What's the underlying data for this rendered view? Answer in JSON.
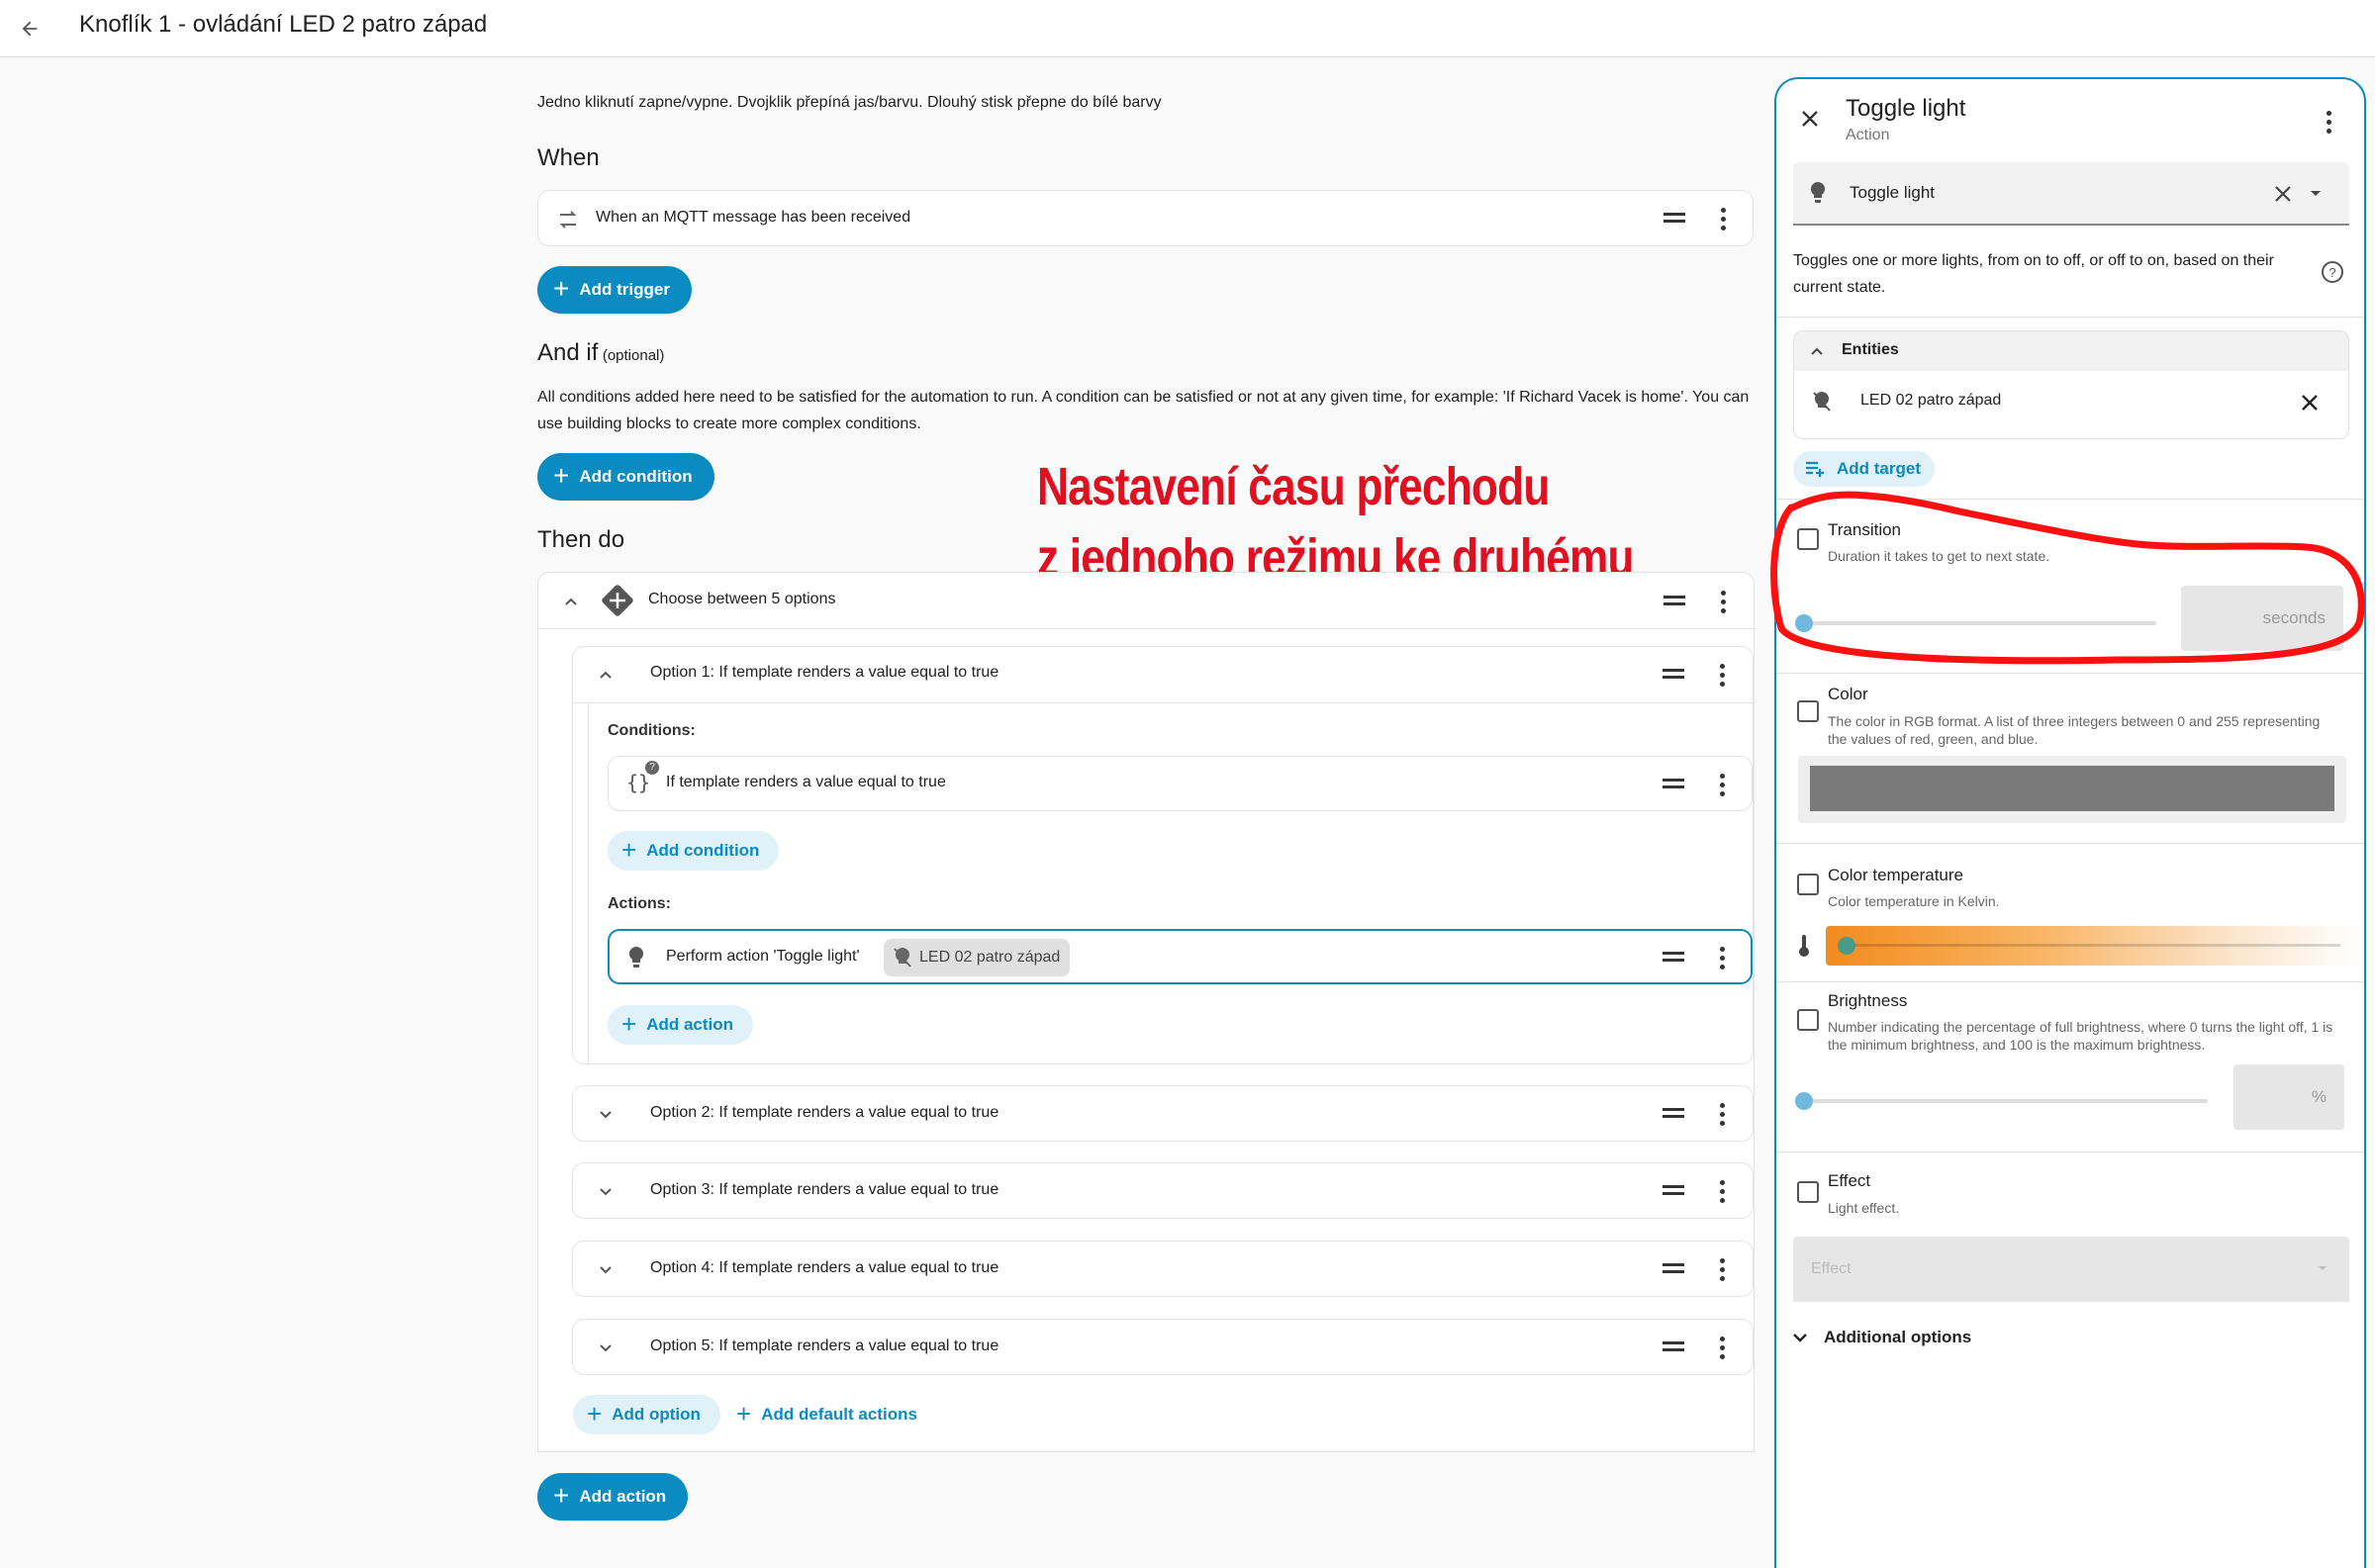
{
  "header": {
    "title": "Knoflík 1 - ovládání LED 2 patro západ"
  },
  "description": "Jedno kliknutí zapne/vypne. Dvojklik přepíná jas/barvu. Dlouhý stisk přepne do bílé barvy",
  "when": {
    "heading": "When",
    "trigger": "When an MQTT message has been received",
    "add_label": "Add trigger"
  },
  "and_if": {
    "heading": "And if",
    "optional": "(optional)",
    "description": "All conditions added here need to be satisfied for the automation to run. A condition can be satisfied or not at any given time, for example: 'If Richard Vacek is home'. You can use building blocks to create more complex conditions.",
    "add_label": "Add condition"
  },
  "then_do": {
    "heading": "Then do",
    "choose_label": "Choose between 5 options",
    "options": [
      "Option 1: If template renders a value equal to true",
      "Option 2: If template renders a value equal to true",
      "Option 3: If template renders a value equal to true",
      "Option 4: If template renders a value equal to true",
      "Option 5: If template renders a value equal to true"
    ],
    "conditions_label": "Conditions:",
    "condition_item": "If template renders a value equal to true",
    "add_condition": "Add condition",
    "actions_label": "Actions:",
    "action_item": "Perform action 'Toggle light'",
    "action_chip": "LED 02 patro západ",
    "add_action_inner": "Add action",
    "add_option": "Add option",
    "add_default": "Add default actions",
    "add_action": "Add action"
  },
  "annotation": {
    "line1": "Nastavení času přechodu",
    "line2": "z jednoho režimu ke druhému"
  },
  "panel": {
    "title": "Toggle light",
    "subtitle": "Action",
    "select_value": "Toggle light",
    "description": "Toggles one or more lights, from on to off, or off to on, based on their current state.",
    "entities_label": "Entities",
    "entity": "LED 02 patro západ",
    "add_target": "Add target",
    "transition": {
      "label": "Transition",
      "help": "Duration it takes to get to next state.",
      "unit": "seconds"
    },
    "color": {
      "label": "Color",
      "help": "The color in RGB format. A list of three integers between 0 and 255 representing the values of red, green, and blue."
    },
    "color_temp": {
      "label": "Color temperature",
      "help": "Color temperature in Kelvin."
    },
    "brightness": {
      "label": "Brightness",
      "help": "Number indicating the percentage of full brightness, where 0 turns the light off, 1 is the minimum brightness, and 100 is the maximum brightness.",
      "unit": "%"
    },
    "effect": {
      "label": "Effect",
      "help": "Light effect.",
      "placeholder": "Effect"
    },
    "additional": "Additional options"
  },
  "colors": {
    "accent": "#0a8bc2",
    "annotation": "#e01020",
    "selected_border": "#0a8bc2"
  }
}
